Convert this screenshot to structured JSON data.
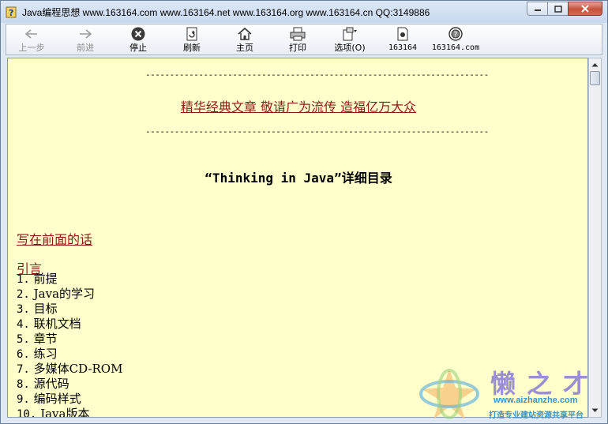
{
  "window": {
    "title": "Java编程思想 www.163164.com www.163164.net www.163164.org www.163164.cn QQ:3149886"
  },
  "toolbar": {
    "back": "上一步",
    "forward": "前进",
    "stop": "停止",
    "refresh": "刷新",
    "home": "主页",
    "print": "打印",
    "options": "选项(O)",
    "site1": "163164",
    "site2": "163164.com"
  },
  "content": {
    "separator": "-----------------------------------------------------------------------",
    "motto": "精华经典文章 敬请广为流传 造福亿万大众",
    "heading": "“Thinking in Java”详细目录",
    "link_preface": "写在前面的话",
    "link_intro": "引言",
    "toc": [
      {
        "num": "1.",
        "text": "前提"
      },
      {
        "num": "2.",
        "text": "Java的学习"
      },
      {
        "num": "3.",
        "text": "目标"
      },
      {
        "num": "4.",
        "text": "联机文档"
      },
      {
        "num": "5.",
        "text": "章节"
      },
      {
        "num": "6.",
        "text": "练习"
      },
      {
        "num": "7.",
        "text": "多媒体CD-ROM"
      },
      {
        "num": "8.",
        "text": "源代码"
      },
      {
        "num": "9.",
        "text": "编码样式"
      },
      {
        "num": "10.",
        "text": "Java版本"
      }
    ]
  },
  "watermark": {
    "brand": "懒之才",
    "url": "www.aizhanzhe.com",
    "slogan": "打造专业建站资源共享平台"
  },
  "colors": {
    "page_background": "#ffffcc",
    "link": "#8b1a1a",
    "chrome": "#dfe8f3",
    "close_button": "#c8503c"
  }
}
